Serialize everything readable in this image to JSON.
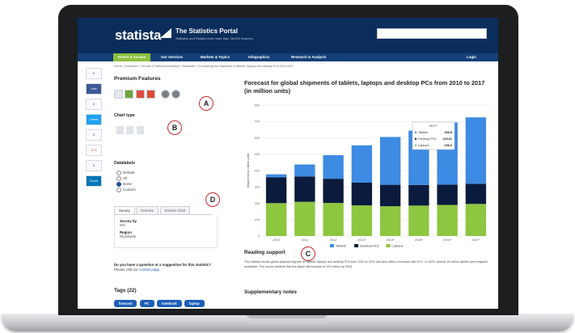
{
  "header": {
    "logo": "statista",
    "portal_title": "The Statistics Portal",
    "portal_sub": "Statistics and Studies from more than 18,000 Sources"
  },
  "nav": {
    "items": [
      "Prices & Access",
      "Our Services",
      "Markets & Topics",
      "Infographics",
      "Research & Analysis",
      "Login"
    ]
  },
  "breadcrumb": "Home > Industries > Technik & Telekommunikation > Hardware > Forecast global shipments of tablets, laptops and desktop PCs 2010-2017",
  "social": {
    "items": [
      "0",
      "Like",
      "0",
      "Tweet",
      "0",
      "G+1",
      "0",
      "Share"
    ]
  },
  "panel": {
    "premium_title": "Premium Features",
    "chart_type_title": "Chart type",
    "datalabels_title": "Datalabels",
    "datalabels_options": [
      "Default",
      "All",
      "None",
      "Custom"
    ],
    "tabs": [
      "Survey",
      "Release",
      "Embed Chart"
    ],
    "survey_by_label": "Survey by",
    "survey_by_value": "IDC",
    "region_label": "Region",
    "region_value": "Worldwide",
    "question": "Do you have a question or a suggestion for this statistic?",
    "question_sub": "Please visit our",
    "question_link": "contact page.",
    "tags_title": "Tags (22)",
    "tags": [
      "forecast",
      "PC",
      "notebook",
      "laptop",
      "",
      ""
    ]
  },
  "markers": [
    "A",
    "B",
    "C",
    "D"
  ],
  "main": {
    "chart_title": "Forecast for global shipments of tablets, laptops and desktop PCs from 2010 to 2017 (in million units)",
    "reading_title": "Reading support",
    "reading_text": "This statistic shows global shipment figures for tablets, laptops and desktop PCs from 2010 to 2012 and also offers a forecast until 2017. In 2010, around 19 million tablets were shipped worldwide. The source predicts that this figure will increase to 332 million by 2015.",
    "supp_title": "Supplementary notes"
  },
  "chart_data": {
    "type": "bar",
    "stacked": true,
    "categories": [
      "2010",
      "2011",
      "2012",
      "2013*",
      "2014*",
      "2015*",
      "2016*",
      "2017*"
    ],
    "series": [
      {
        "name": "Laptops",
        "color": "#8dc63f",
        "values": [
          201,
          209,
          202,
          187,
          182,
          186,
          190,
          196
        ]
      },
      {
        "name": "Desktop-PCs",
        "color": "#0a1b3d",
        "values": [
          157,
          155,
          148,
          139,
          131,
          126,
          124,
          123
        ]
      },
      {
        "name": "Tablets",
        "color": "#3d8be2",
        "values": [
          19,
          73,
          144,
          228,
          292,
          332,
          380,
          406
        ]
      }
    ],
    "ylabel": "Shipments in million units",
    "ylim": [
      0,
      800
    ],
    "yticks": [
      0,
      100,
      200,
      300,
      400,
      500,
      600,
      700,
      800
    ],
    "grid": true,
    "legend": "bottom",
    "tooltip": {
      "title": "2017*",
      "rows": [
        {
          "label": "Tablets",
          "value": "406.8"
        },
        {
          "label": "Desktop-PCs",
          "value": "123.01"
        },
        {
          "label": "Laptops",
          "value": "196.6"
        }
      ]
    }
  }
}
